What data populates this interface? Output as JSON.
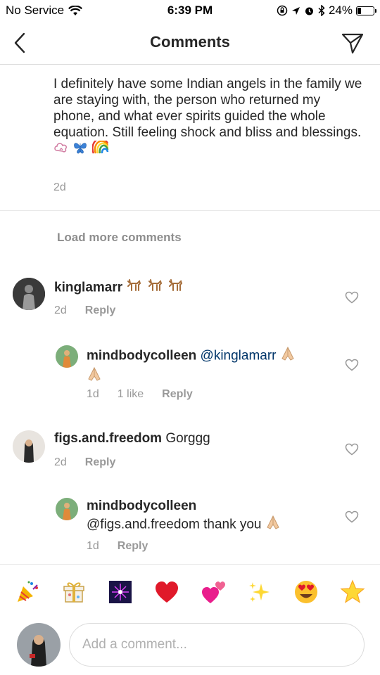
{
  "status_bar": {
    "carrier": "No Service",
    "time": "6:39 PM",
    "battery_percent": "24%",
    "battery_level": 0.24
  },
  "nav": {
    "title": "Comments"
  },
  "caption": {
    "text": "I definitely have some Indian angels in the family we are staying with, the person who returned my phone, and what ever spirits guided the whole equation. Still feeling shock and bliss and blessings.",
    "time": "2d"
  },
  "load_more": "Load more comments",
  "comments": [
    {
      "username": "kinglamarr",
      "text": "",
      "time": "2d",
      "likes": "",
      "reply": "Reply"
    },
    {
      "username": "mindbodycolleen",
      "text": "@kinglamarr",
      "time": "1d",
      "likes": "1 like",
      "reply": "Reply"
    },
    {
      "username": "figs.and.freedom",
      "text": "Gorggg",
      "time": "2d",
      "likes": "",
      "reply": "Reply"
    },
    {
      "username": "mindbodycolleen",
      "text": "@figs.and.freedom thank you",
      "time": "1d",
      "likes": "",
      "reply": "Reply"
    }
  ],
  "emoji_bar": [
    {
      "name": "party-popper",
      "glyph": "🎉"
    },
    {
      "name": "gift",
      "glyph": "🎁"
    },
    {
      "name": "fireworks",
      "glyph": "🎆"
    },
    {
      "name": "red-heart",
      "glyph": "❤️"
    },
    {
      "name": "two-hearts",
      "glyph": "💕"
    },
    {
      "name": "sparkles",
      "glyph": "✨"
    },
    {
      "name": "heart-eyes",
      "glyph": "😍"
    },
    {
      "name": "star",
      "glyph": "⭐"
    }
  ],
  "input": {
    "placeholder": "Add a comment..."
  }
}
